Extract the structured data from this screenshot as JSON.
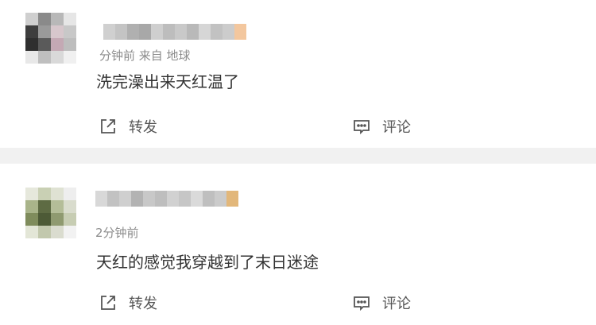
{
  "comments": [
    {
      "meta": "分钟前 来自 地球",
      "content": "洗完澡出来天红温了",
      "repost_label": "转发",
      "comment_label": "评论",
      "avatar_pixels": [
        "#cfcfcf",
        "#8a8a8a",
        "#b8b8b8",
        "#e6e6e6",
        "#3e3e3e",
        "#9a9a9a",
        "#d7c7cc",
        "#c8c8c8",
        "#2f2f2f",
        "#5a5a5a",
        "#c4a9b4",
        "#bdbdbd",
        "#e8e8e8",
        "#bfbfbf",
        "#d9d9d9",
        "#f0f0f0"
      ],
      "name_pixels": [
        "#d0d0d0",
        "#c4c4c4",
        "#b0b0b0",
        "#a8a8a8",
        "#cfcfcf",
        "#bdbdbd",
        "#c9c9c9",
        "#b9b9b9",
        "#d6d6d6",
        "#c2c2c2",
        "#cccccc",
        "#f3c79e"
      ]
    },
    {
      "meta": "2分钟前",
      "content": "天红的感觉我穿越到了末日迷途",
      "repost_label": "转发",
      "comment_label": "评论",
      "avatar_pixels": [
        "#e6e8dc",
        "#c9d0b4",
        "#dfe2d3",
        "#eeeeee",
        "#a9b48a",
        "#5e6b43",
        "#b4bd98",
        "#d9dccd",
        "#7f8c5c",
        "#4d5a36",
        "#8f9a70",
        "#c7cdb3",
        "#e3e6d7",
        "#c2c8ad",
        "#dadccf",
        "#f2f2f2"
      ],
      "name_pixels": [
        "#d8d8d8",
        "#c2c2c2",
        "#cfcfcf",
        "#b3b3b3",
        "#c8c8c8",
        "#bebebe",
        "#d1d1d1",
        "#c6c6c6",
        "#dadada",
        "#bfbfbf",
        "#cbcbcb",
        "#e2b77a"
      ]
    }
  ]
}
